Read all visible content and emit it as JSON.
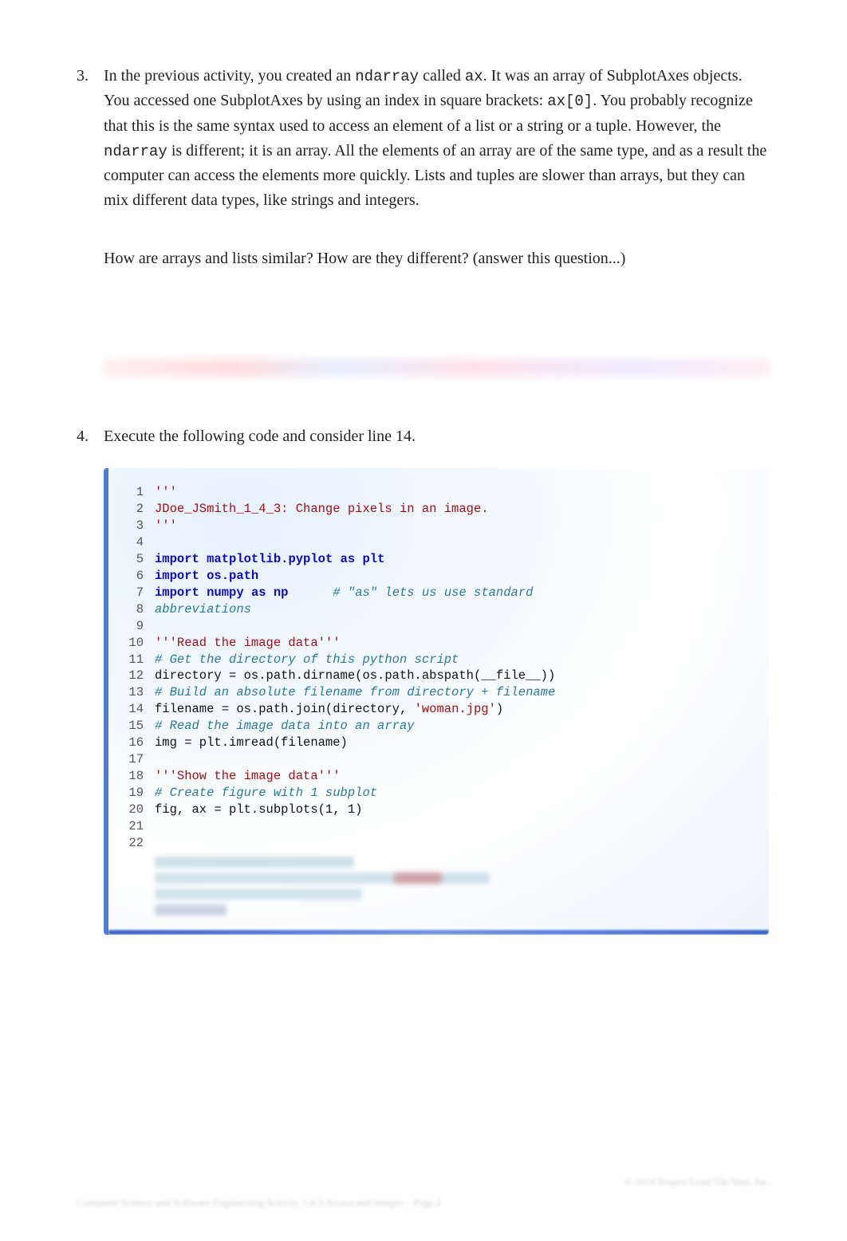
{
  "items": [
    {
      "number": "3.",
      "para1_pre": "In the previous activity, you created an ",
      "code1": "ndarray",
      "para1_mid1": " called ",
      "code2": "ax",
      "para1_mid2": ". It was an array of SubplotAxes objects. You accessed one SubplotAxes by using an index in square brackets: ",
      "code3": "ax[0]",
      "para1_mid3": ". You probably recognize that this is the same syntax used to access an element of a list or a string or a tuple. However, the ",
      "code4": "ndarray",
      "para1_post": " is different; it is an array. All the elements of an array are of the same type, and as a result the computer can access the elements more quickly. Lists and tuples are slower than arrays, but they can mix different data types, like strings and integers.",
      "para2": "How are arrays and lists similar? How are they different? (answer this question...)"
    },
    {
      "number": "4.",
      "para1": "Execute the following code and consider line 14."
    }
  ],
  "code": {
    "line_start": 1,
    "line_end": 22,
    "lines": {
      "l1": {
        "s": "'''"
      },
      "l2": {
        "s": "JDoe_JSmith_1_4_3: Change pixels in an image."
      },
      "l3": {
        "s": "'''"
      },
      "l4": {
        "plain": ""
      },
      "l5": {
        "kw": "import",
        "sp": " ",
        "mod": "matplotlib.pyplot",
        "sp2": " ",
        "kw2": "as",
        "sp3": " ",
        "mod2": "plt"
      },
      "l6": {
        "kw": "import",
        "sp": " ",
        "mod": "os.path"
      },
      "l7": {
        "kw": "import",
        "sp": " ",
        "mod": "numpy",
        "sp2": " ",
        "kw2": "as",
        "sp3": " ",
        "mod2": "np",
        "pad": "      ",
        "cmt": "# \"as\" lets us use standard"
      },
      "l8": {
        "cmt": "abbreviations"
      },
      "l9": {
        "plain": ""
      },
      "l10": {
        "s": "'''Read the image data'''"
      },
      "l11": {
        "cmt": "# Get the directory of this python script"
      },
      "l12": {
        "plain": "directory = os.path.dirname(os.path.abspath(__file__))"
      },
      "l13": {
        "cmt": "# Build an absolute filename from directory + filename"
      },
      "l14": {
        "plain_pre": "filename = os.path.join(directory, ",
        "s": "'woman.jpg'",
        "plain_post": ")"
      },
      "l15": {
        "cmt": "# Read the image data into an array"
      },
      "l16": {
        "plain": "img = plt.imread(filename)"
      },
      "l17": {
        "plain": ""
      },
      "l18": {
        "s": "'''Show the image data'''"
      },
      "l19": {
        "cmt": "# Create figure with 1 subplot"
      },
      "l20": {
        "plain": "fig, ax = plt.subplots(1, 1)"
      },
      "l21": {
        "plain": ""
      },
      "l22": {
        "plain": ""
      }
    }
  },
  "footer": {
    "copyright": "© 2014 Project Lead The Way, Inc.",
    "line": "Computer Science and Software Engineering Activity 1.4.3 Arrays and Images – Page 2"
  }
}
